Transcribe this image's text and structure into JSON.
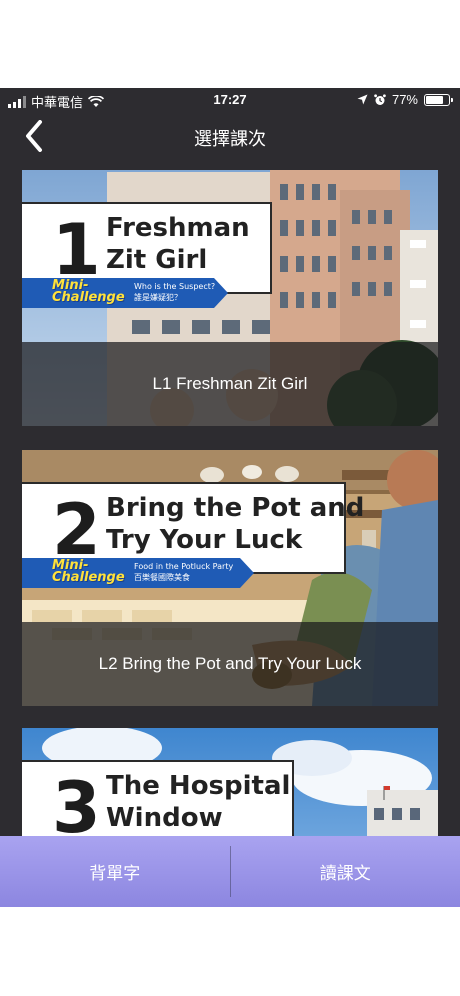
{
  "status_bar": {
    "carrier": "中華電信",
    "time": "17:27",
    "battery": "77%",
    "battery_level": 0.77
  },
  "navbar": {
    "title": "選擇課次"
  },
  "lessons": [
    {
      "number": "1",
      "title_line1": "Freshman",
      "title_line2": "Zit Girl",
      "mini_challenge_badge_line1": "Mini-",
      "mini_challenge_badge_line2": "Challenge",
      "mini_challenge_en": "Who is the Suspect?",
      "mini_challenge_zh": "誰是嫌疑犯？",
      "caption": "L1  Freshman Zit Girl"
    },
    {
      "number": "2",
      "title_line1": "Bring the Pot and",
      "title_line2": "Try Your Luck",
      "mini_challenge_badge_line1": "Mini-",
      "mini_challenge_badge_line2": "Challenge",
      "mini_challenge_en": "Food in the Potluck Party",
      "mini_challenge_zh": "百樂餐國際美食",
      "caption": "L2  Bring the Pot and Try Your Luck"
    },
    {
      "number": "3",
      "title_line1": "The Hospital",
      "title_line2": "Window",
      "caption": ""
    }
  ],
  "bottom_bar": {
    "left_label": "背單字",
    "right_label": "讀課文",
    "color": "#9b95e8"
  },
  "icons": {
    "back": "chevron-left-icon",
    "wifi": "wifi-icon",
    "location": "location-arrow-icon",
    "alarm": "alarm-icon"
  }
}
